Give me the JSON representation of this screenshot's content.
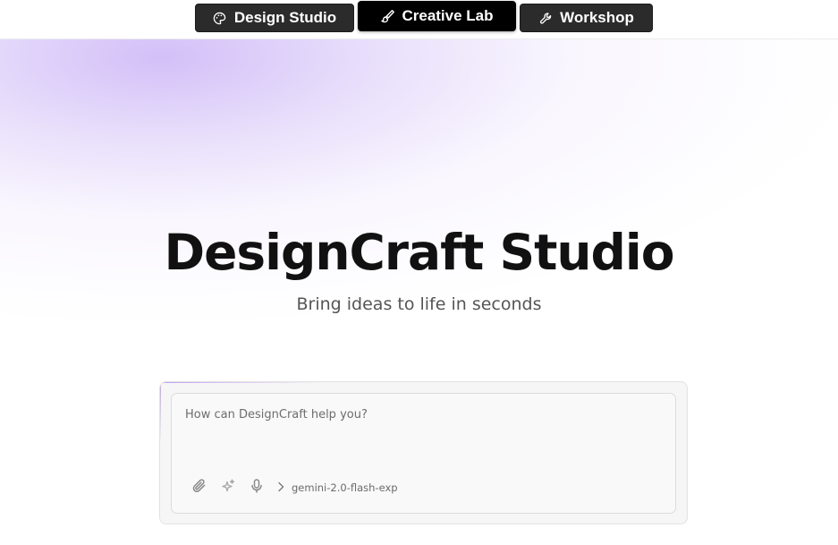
{
  "tabs": [
    {
      "label": "Design Studio",
      "icon": "palette-icon",
      "active": false
    },
    {
      "label": "Creative Lab",
      "icon": "paintbrush-icon",
      "active": true
    },
    {
      "label": "Workshop",
      "icon": "wrench-icon",
      "active": false
    }
  ],
  "hero": {
    "title": "DesignCraft Studio",
    "subtitle": "Bring ideas to life in seconds"
  },
  "composer": {
    "placeholder": "How can DesignCraft help you?",
    "value": "",
    "tools": [
      {
        "icon": "paperclip-icon"
      },
      {
        "icon": "sparkles-icon"
      },
      {
        "icon": "microphone-icon"
      }
    ],
    "model": "gemini-2.0-flash-exp"
  },
  "colors": {
    "tab_background": "#2b2b2b",
    "tab_active_background": "#000000",
    "hero_gradient": "#c4aaf5"
  }
}
